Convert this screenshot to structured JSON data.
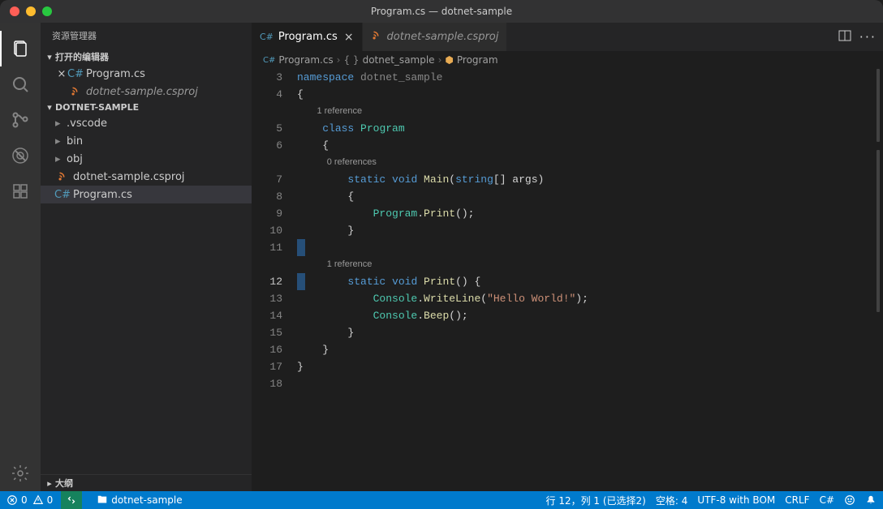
{
  "title": "Program.cs — dotnet-sample",
  "sidebar": {
    "header": "资源管理器",
    "sections": {
      "open_editors": "打开的编辑器",
      "project": "DOTNET-SAMPLE",
      "outline": "大纲"
    },
    "open_files": [
      {
        "name": "Program.cs",
        "icon": "cs",
        "active": true
      },
      {
        "name": "dotnet-sample.csproj",
        "icon": "xml",
        "active": false
      }
    ],
    "tree": [
      {
        "name": ".vscode",
        "type": "folder"
      },
      {
        "name": "bin",
        "type": "folder"
      },
      {
        "name": "obj",
        "type": "folder"
      },
      {
        "name": "dotnet-sample.csproj",
        "type": "file",
        "icon": "xml"
      },
      {
        "name": "Program.cs",
        "type": "file",
        "icon": "cs",
        "selected": true
      }
    ]
  },
  "tabs": [
    {
      "name": "Program.cs",
      "icon": "cs",
      "active": true
    },
    {
      "name": "dotnet-sample.csproj",
      "icon": "xml",
      "active": false
    }
  ],
  "breadcrumb": {
    "file": "Program.cs",
    "ns": "dotnet_sample",
    "cls": "Program"
  },
  "code": {
    "codelens1": "1 reference",
    "codelens0": "0 references",
    "lines": {
      "l3": {
        "n": "3",
        "kw": "namespace",
        "rest": " dotnet_sample"
      },
      "l4": {
        "n": "4",
        "txt": "{"
      },
      "l5": {
        "n": "5",
        "kw": "class",
        "cls": " Program"
      },
      "l6": {
        "n": "6",
        "txt": "    {"
      },
      "l7": {
        "n": "7",
        "kw1": "static",
        "kw2": " void",
        "fn": " Main",
        "p1": "(",
        "tp": "string",
        "rest": "[] args)"
      },
      "l8": {
        "n": "8",
        "txt": "        {"
      },
      "l9": {
        "n": "9",
        "cls": "Program",
        "dot": ".",
        "fn": "Print",
        "rest": "();"
      },
      "l10": {
        "n": "10",
        "txt": "        }"
      },
      "l11": {
        "n": "11",
        "txt": ""
      },
      "l12": {
        "n": "12",
        "kw1": "static",
        "kw2": " void",
        "fn": " Print",
        "rest": "() {"
      },
      "l13": {
        "n": "13",
        "cls": "Console",
        "dot": ".",
        "fn": "WriteLine",
        "p1": "(",
        "str": "\"Hello World!\"",
        "rest": ");"
      },
      "l14": {
        "n": "14",
        "cls": "Console",
        "dot": ".",
        "fn": "Beep",
        "rest": "();"
      },
      "l15": {
        "n": "15",
        "txt": "        }"
      },
      "l16": {
        "n": "16",
        "txt": "    }"
      },
      "l17": {
        "n": "17",
        "txt": "}"
      },
      "l18": {
        "n": "18",
        "txt": ""
      }
    }
  },
  "status": {
    "errors": "0",
    "warnings": "0",
    "branch": "dotnet-sample",
    "pos": "行 12，列 1 (已选择2)",
    "spaces": "空格: 4",
    "encoding": "UTF-8 with BOM",
    "eol": "CRLF",
    "lang": "C#"
  }
}
